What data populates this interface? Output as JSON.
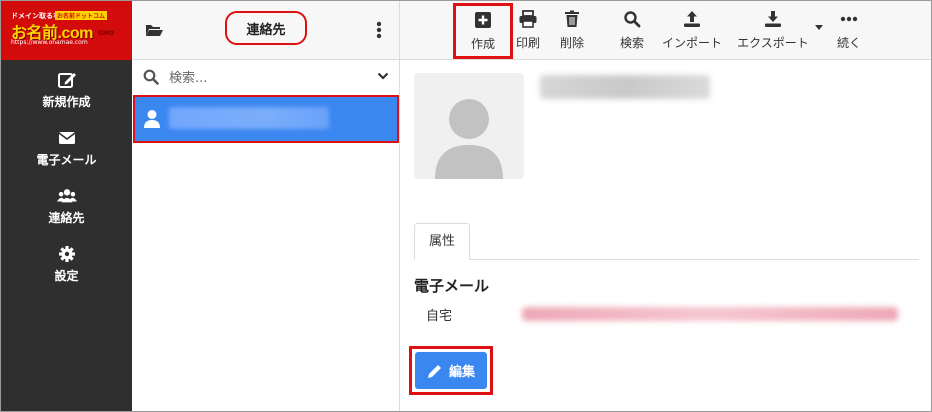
{
  "logo": {
    "tagline": "ドメイン取るなら",
    "tagline_badge": "お名前ドットコム",
    "brand": "お名前.com",
    "url": "https://www.onamae.com",
    "by": "GMO"
  },
  "nav": {
    "items": [
      {
        "label": "新規作成",
        "icon": "compose-icon"
      },
      {
        "label": "電子メール",
        "icon": "envelope-icon"
      },
      {
        "label": "連絡先",
        "icon": "users-icon"
      },
      {
        "label": "設定",
        "icon": "gear-icon"
      }
    ]
  },
  "list": {
    "title": "連絡先",
    "search_placeholder": "検索..."
  },
  "toolbar": {
    "create": "作成",
    "print": "印刷",
    "delete": "削除",
    "search": "検索",
    "import": "インポート",
    "export": "エクスポート",
    "more": "続く"
  },
  "contact": {
    "tab_label": "属性",
    "section_email": "電子メール",
    "email_type": "自宅",
    "edit_label": "編集"
  },
  "colors": {
    "accent": "#3b87f0",
    "highlight": "#dd1111",
    "nav_bg": "#2f2f2f",
    "logo_bg": "#d30b0b"
  }
}
